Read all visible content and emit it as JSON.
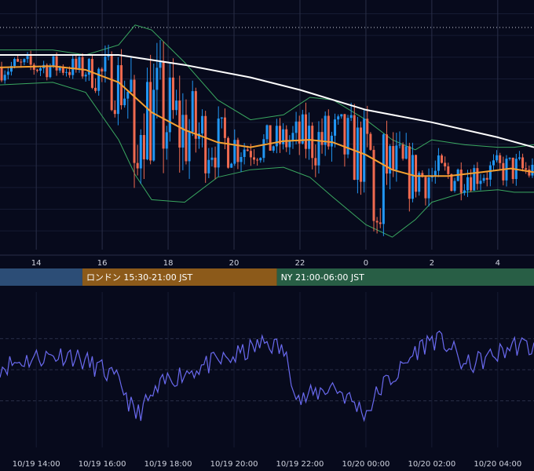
{
  "chart_data": [
    {
      "type": "candlestick",
      "panel": "price",
      "x_ticks": [
        "14",
        "16",
        "18",
        "20",
        "22",
        "0",
        "2",
        "4"
      ],
      "x_tick_hours": [
        14,
        16,
        18,
        20,
        22,
        24,
        26,
        28
      ],
      "x_range_hours": [
        12.9,
        29.1
      ],
      "y_range": [
        0,
        100
      ],
      "up_color": "#2196f3",
      "down_color": "#ef6a50",
      "reference_line": {
        "value": 89,
        "style": "dotted",
        "color": "#d0d4e0"
      },
      "series": [
        {
          "kind": "moving_average_long",
          "color": "#ffffff",
          "points": [
            [
              12.9,
              78
            ],
            [
              15,
              78
            ],
            [
              16.5,
              78
            ],
            [
              18.5,
              74
            ],
            [
              20.5,
              69
            ],
            [
              22,
              64
            ],
            [
              24,
              56
            ],
            [
              26,
              51
            ],
            [
              28,
              45
            ],
            [
              29.1,
              41
            ]
          ]
        },
        {
          "kind": "moving_average_short",
          "color": "#f5a030",
          "points": [
            [
              12.9,
              73
            ],
            [
              14.5,
              73.5
            ],
            [
              15.5,
              72
            ],
            [
              16.5,
              67
            ],
            [
              17.5,
              55
            ],
            [
              18.5,
              48
            ],
            [
              19.5,
              43
            ],
            [
              20.5,
              41
            ],
            [
              21.5,
              43.5
            ],
            [
              22.3,
              44
            ],
            [
              23,
              43
            ],
            [
              24,
              38
            ],
            [
              24.8,
              32
            ],
            [
              25.5,
              29.5
            ],
            [
              26.5,
              29.5
            ],
            [
              27.5,
              31
            ],
            [
              28.4,
              32.5
            ],
            [
              29.1,
              31
            ]
          ]
        },
        {
          "kind": "bollinger_upper",
          "color": "#3aa860",
          "points": [
            [
              12.9,
              80
            ],
            [
              14.5,
              80
            ],
            [
              15.5,
              78
            ],
            [
              16.5,
              82
            ],
            [
              17,
              90
            ],
            [
              17.5,
              88
            ],
            [
              18.5,
              75
            ],
            [
              19.5,
              60
            ],
            [
              20.5,
              52
            ],
            [
              21.5,
              54
            ],
            [
              22.3,
              61
            ],
            [
              23,
              60
            ],
            [
              24,
              52
            ],
            [
              24.8,
              44
            ],
            [
              25.5,
              40
            ],
            [
              26,
              44
            ],
            [
              27,
              42
            ],
            [
              28,
              41
            ],
            [
              28.5,
              41
            ],
            [
              29.1,
              42
            ]
          ]
        },
        {
          "kind": "bollinger_lower",
          "color": "#3aa860",
          "points": [
            [
              12.9,
              66
            ],
            [
              14.5,
              67
            ],
            [
              15.5,
              63
            ],
            [
              16.5,
              44
            ],
            [
              17,
              30
            ],
            [
              17.5,
              20
            ],
            [
              18.5,
              19
            ],
            [
              19.5,
              29
            ],
            [
              20.5,
              32
            ],
            [
              21.5,
              33
            ],
            [
              22.3,
              29
            ],
            [
              23,
              21
            ],
            [
              24,
              10
            ],
            [
              24.8,
              5
            ],
            [
              25.5,
              12
            ],
            [
              26,
              19
            ],
            [
              27,
              23
            ],
            [
              28,
              24
            ],
            [
              28.5,
              23
            ],
            [
              29.1,
              23
            ]
          ]
        },
        {
          "kind": "candles",
          "shape": "noisy walk around short MA, ~165 bars",
          "start": 73,
          "seed": 7
        }
      ]
    },
    {
      "type": "line",
      "panel": "oscillator",
      "y_range": [
        0,
        100
      ],
      "color": "#6a6af0",
      "seed": 11,
      "guide_levels": [
        30,
        50,
        70
      ],
      "x_ticks": [
        "10/19 14:00",
        "10/19 16:00",
        "10/19 18:00",
        "10/19 20:00",
        "10/19 22:00",
        "10/20 00:00",
        "10/20 02:00",
        "10/20 04:00"
      ],
      "x_tick_hours": [
        14,
        16,
        18,
        20,
        22,
        24,
        26,
        28
      ],
      "anchors": [
        [
          12.9,
          52
        ],
        [
          14,
          58
        ],
        [
          15,
          60
        ],
        [
          16,
          50
        ],
        [
          16.6,
          40
        ],
        [
          17,
          20
        ],
        [
          18,
          44
        ],
        [
          19,
          52
        ],
        [
          20,
          58
        ],
        [
          21,
          68
        ],
        [
          21.5,
          62
        ],
        [
          22,
          30
        ],
        [
          23,
          40
        ],
        [
          24,
          22
        ],
        [
          24.5,
          40
        ],
        [
          25,
          48
        ],
        [
          25.5,
          62
        ],
        [
          26,
          70
        ],
        [
          26.5,
          66
        ],
        [
          27,
          52
        ],
        [
          28,
          60
        ],
        [
          28.5,
          66
        ],
        [
          29.1,
          64
        ]
      ]
    }
  ],
  "sessions": [
    {
      "label": "",
      "color": "#2c4d76",
      "start_hour": 12.9,
      "end_hour": 15.4
    },
    {
      "label": "ロンドン 15:30-21:00 JST",
      "color": "#8c5a1a",
      "start_hour": 15.4,
      "end_hour": 21.3
    },
    {
      "label": "NY 21:00-06:00 JST",
      "color": "#285e45",
      "start_hour": 21.3,
      "end_hour": 29.1
    }
  ]
}
